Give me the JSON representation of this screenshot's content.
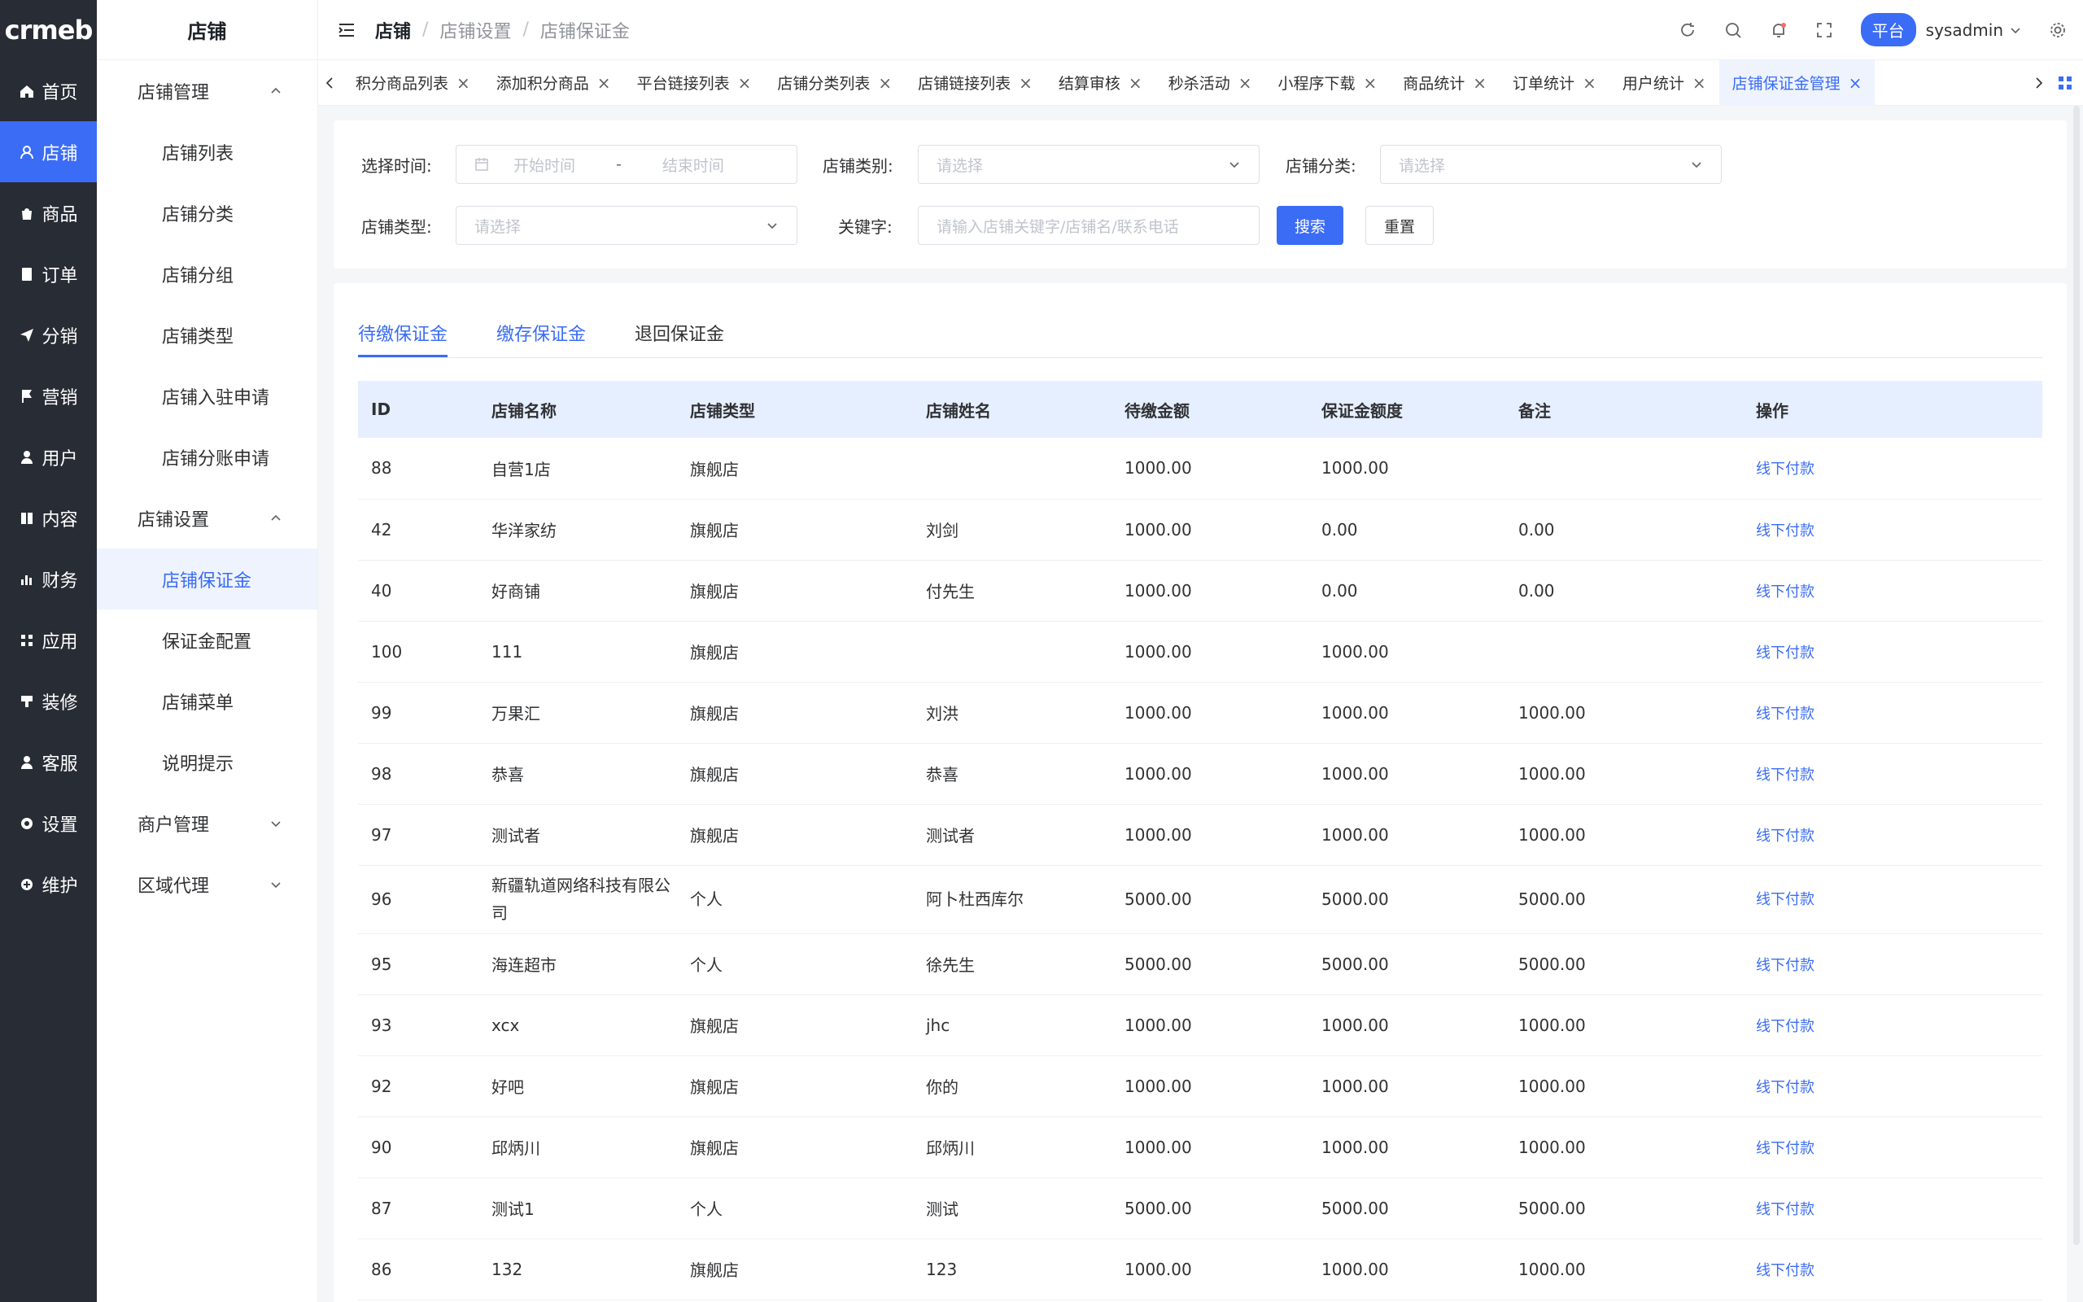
{
  "brand": {
    "logo": "crmeb"
  },
  "rail": {
    "items": [
      {
        "label": "首页",
        "icon": "home-icon"
      },
      {
        "label": "店铺",
        "icon": "store-icon",
        "active": true
      },
      {
        "label": "商品",
        "icon": "bag-icon"
      },
      {
        "label": "订单",
        "icon": "order-icon"
      },
      {
        "label": "分销",
        "icon": "send-icon"
      },
      {
        "label": "营销",
        "icon": "flag-icon"
      },
      {
        "label": "用户",
        "icon": "user-icon"
      },
      {
        "label": "内容",
        "icon": "book-icon"
      },
      {
        "label": "财务",
        "icon": "chart-icon"
      },
      {
        "label": "应用",
        "icon": "grid-icon"
      },
      {
        "label": "装修",
        "icon": "brush-icon"
      },
      {
        "label": "客服",
        "icon": "service-icon"
      },
      {
        "label": "设置",
        "icon": "gear-icon"
      },
      {
        "label": "维护",
        "icon": "tool-icon"
      }
    ]
  },
  "sidebar": {
    "title": "店铺",
    "group1": "店铺管理",
    "group1_items": [
      "店铺列表",
      "店铺分类",
      "店铺分组",
      "店铺类型",
      "店铺入驻申请",
      "店铺分账申请"
    ],
    "group2": "店铺设置",
    "group2_items": [
      "店铺保证金",
      "保证金配置",
      "店铺菜单",
      "说明提示"
    ],
    "group3": "商户管理",
    "group4": "区域代理"
  },
  "header": {
    "crumb_root": "店铺",
    "crumb_mid": "店铺设置",
    "crumb_leaf": "店铺保证金",
    "platform": "平台",
    "user": "sysadmin"
  },
  "tabs": [
    "积分商品列表",
    "添加积分商品",
    "平台链接列表",
    "店铺分类列表",
    "店铺链接列表",
    "结算审核",
    "秒杀活动",
    "小程序下载",
    "商品统计",
    "订单统计",
    "用户统计",
    "店铺保证金管理"
  ],
  "filters": {
    "time_label": "选择时间:",
    "start_placeholder": "开始时间",
    "range_sep": "-",
    "end_placeholder": "结束时间",
    "category_label": "店铺类别:",
    "category_placeholder": "请选择",
    "class_label": "店铺分类:",
    "class_placeholder": "请选择",
    "type_label": "店铺类型:",
    "type_placeholder": "请选择",
    "keyword_label": "关键字:",
    "keyword_placeholder": "请输入店铺关键字/店铺名/联系电话",
    "search": "搜索",
    "reset": "重置"
  },
  "subtabs": [
    "待缴保证金",
    "缴存保证金",
    "退回保证金"
  ],
  "table": {
    "headers": [
      "ID",
      "店铺名称",
      "店铺类型",
      "店铺姓名",
      "待缴金额",
      "保证金额度",
      "备注",
      "操作"
    ],
    "action": "线下付款",
    "rows": [
      [
        "88",
        "自营1店",
        "旗舰店",
        "",
        "1000.00",
        "1000.00",
        ""
      ],
      [
        "42",
        "华洋家纺",
        "旗舰店",
        "刘剑",
        "1000.00",
        "0.00",
        "0.00"
      ],
      [
        "40",
        "好商铺",
        "旗舰店",
        "付先生",
        "1000.00",
        "0.00",
        "0.00"
      ],
      [
        "100",
        "111",
        "旗舰店",
        "",
        "1000.00",
        "1000.00",
        ""
      ],
      [
        "99",
        "万果汇",
        "旗舰店",
        "刘洪",
        "1000.00",
        "1000.00",
        "1000.00"
      ],
      [
        "98",
        "恭喜",
        "旗舰店",
        "恭喜",
        "1000.00",
        "1000.00",
        "1000.00"
      ],
      [
        "97",
        "测试者",
        "旗舰店",
        "测试者",
        "1000.00",
        "1000.00",
        "1000.00"
      ],
      [
        "96",
        "新疆轨道网络科技有限公司",
        "个人",
        "阿卜杜西库尔",
        "5000.00",
        "5000.00",
        "5000.00"
      ],
      [
        "95",
        "海连超市",
        "个人",
        "徐先生",
        "5000.00",
        "5000.00",
        "5000.00"
      ],
      [
        "93",
        "xcx",
        "旗舰店",
        "jhc",
        "1000.00",
        "1000.00",
        "1000.00"
      ],
      [
        "92",
        "好吧",
        "旗舰店",
        "你的",
        "1000.00",
        "1000.00",
        "1000.00"
      ],
      [
        "90",
        "邱炳川",
        "旗舰店",
        "邱炳川",
        "1000.00",
        "1000.00",
        "1000.00"
      ],
      [
        "87",
        "测试1",
        "个人",
        "测试",
        "5000.00",
        "5000.00",
        "5000.00"
      ],
      [
        "86",
        "132",
        "旗舰店",
        "123",
        "1000.00",
        "1000.00",
        "1000.00"
      ]
    ]
  }
}
